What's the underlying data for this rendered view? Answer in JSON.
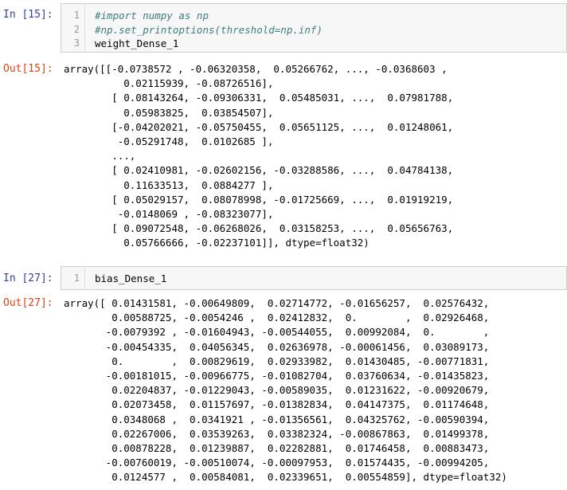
{
  "cell1": {
    "in_prompt": "In [15]:",
    "line_numbers": [
      "1",
      "2",
      "3"
    ],
    "code": [
      "#import numpy as np",
      "#np.set_printoptions(threshold=np.inf)",
      "weight_Dense_1"
    ],
    "out_prompt": "Out[15]:",
    "output": [
      "array([[-0.0738572 , -0.06320358,  0.05266762, ..., -0.0368603 ,",
      "          0.02115939, -0.08726516],",
      "        [ 0.08143264, -0.09306331,  0.05485031, ...,  0.07981788,",
      "          0.05983825,  0.03854507],",
      "        [-0.04202021, -0.05750455,  0.05651125, ...,  0.01248061,",
      "         -0.05291748,  0.0102685 ],",
      "        ...,",
      "        [ 0.02410981, -0.02602156, -0.03288586, ...,  0.04784138,",
      "          0.11633513,  0.0884277 ],",
      "        [ 0.05029157,  0.08078998, -0.01725669, ...,  0.01919219,",
      "         -0.0148069 , -0.08323077],",
      "        [ 0.09072548, -0.06268026,  0.03158253, ...,  0.05656763,",
      "          0.05766666, -0.02237101]], dtype=float32)"
    ]
  },
  "cell2": {
    "in_prompt": "In [27]:",
    "line_numbers": [
      "1"
    ],
    "code": [
      "bias_Dense_1"
    ],
    "out_prompt": "Out[27]:",
    "output": [
      "array([ 0.01431581, -0.00649809,  0.02714772, -0.01656257,  0.02576432,",
      "        0.00588725, -0.0054246 ,  0.02412832,  0.        ,  0.02926468,",
      "       -0.0079392 , -0.01604943, -0.00544055,  0.00992084,  0.        ,",
      "       -0.00454335,  0.04056345,  0.02636978, -0.00061456,  0.03089173,",
      "        0.        ,  0.00829619,  0.02933982,  0.01430485, -0.00771831,",
      "       -0.00181015, -0.00966775, -0.01082704,  0.03760634, -0.01435823,",
      "        0.02204837, -0.01229043, -0.00589035,  0.01231622, -0.00920679,",
      "        0.02073458,  0.01157697, -0.01382834,  0.04147375,  0.01174648,",
      "        0.0348068 ,  0.0341921 , -0.01356561,  0.04325762, -0.00590394,",
      "        0.02267006,  0.03539263,  0.03382324, -0.00867863,  0.01499378,",
      "        0.00878228,  0.01239887,  0.02282881,  0.01746458,  0.00883473,",
      "       -0.00760019, -0.00510074, -0.00097953,  0.01574435, -0.00994205,",
      "        0.0124577 ,  0.00584081,  0.02339651,  0.00554859], dtype=float32)"
    ]
  }
}
